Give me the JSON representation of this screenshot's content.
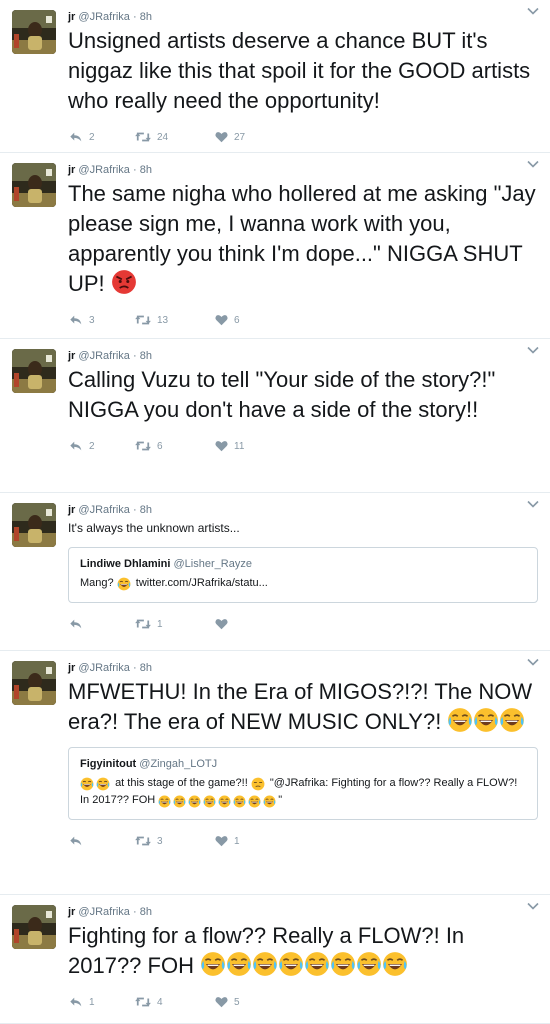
{
  "colors": {
    "accent": "#1da1f2",
    "meta": "#657786",
    "icon": "#8899a6",
    "divider": "#e6ecf0",
    "emoji": "#fbc02d"
  },
  "icons": {
    "reply": "reply-arrow-icon",
    "retweet": "retweet-icon",
    "like": "heart-icon",
    "more": "chevron-down-icon",
    "laugh": "tears-of-joy-emoji",
    "angry": "angry-face-emoji",
    "unamused": "unamused-face-emoji"
  },
  "tweets": [
    {
      "name": "jr",
      "handle": "@JRafrika",
      "time": "· 8h",
      "text": "Unsigned artists deserve a chance BUT it's niggaz like this that spoil it for the GOOD artists who really need the opportunity!",
      "replies": "2",
      "retweets": "24",
      "likes": "27"
    },
    {
      "name": "jr",
      "handle": "@JRafrika",
      "time": "· 8h",
      "text": "The same nigha who hollered at me asking \"Jay please sign me, I wanna work with you, apparently you think I'm dope...\" NIGGA SHUT UP!",
      "replies": "3",
      "retweets": "13",
      "likes": "6"
    },
    {
      "name": "jr",
      "handle": "@JRafrika",
      "time": "· 8h",
      "text": "Calling Vuzu to tell \"Your side of the story?!\" NIGGA you don't have a side of the story!!",
      "replies": "2",
      "retweets": "6",
      "likes": "11"
    },
    {
      "name": "jr",
      "handle": "@JRafrika",
      "time": "· 8h",
      "text": "It's always the unknown artists...",
      "quote": {
        "name": "Lindiwe Dhlamini",
        "handle": "@Lisher_Rayze",
        "text_before": "Mang?",
        "text_after": "twitter.com/JRafrika/statu..."
      },
      "replies": "",
      "retweets": "1",
      "likes": ""
    },
    {
      "name": "jr",
      "handle": "@JRafrika",
      "time": "· 8h",
      "text": "MFWETHU! In the Era of MIGOS?!?! The NOW era?! The era of NEW MUSIC ONLY?!",
      "quote": {
        "name": "Figyinitout",
        "handle": "@Zingah_LOTJ",
        "text_a": "at this stage of the game?!!",
        "text_b": "\"@JRafrika: Fighting for a flow?? Really a FLOW?! In 2017?? FOH",
        "text_c": "\""
      },
      "replies": "",
      "retweets": "3",
      "likes": "1"
    },
    {
      "name": "jr",
      "handle": "@JRafrika",
      "time": "· 8h",
      "text": "Fighting for a flow??  Really a FLOW?! In 2017?? FOH",
      "replies": "1",
      "retweets": "4",
      "likes": "5"
    }
  ]
}
